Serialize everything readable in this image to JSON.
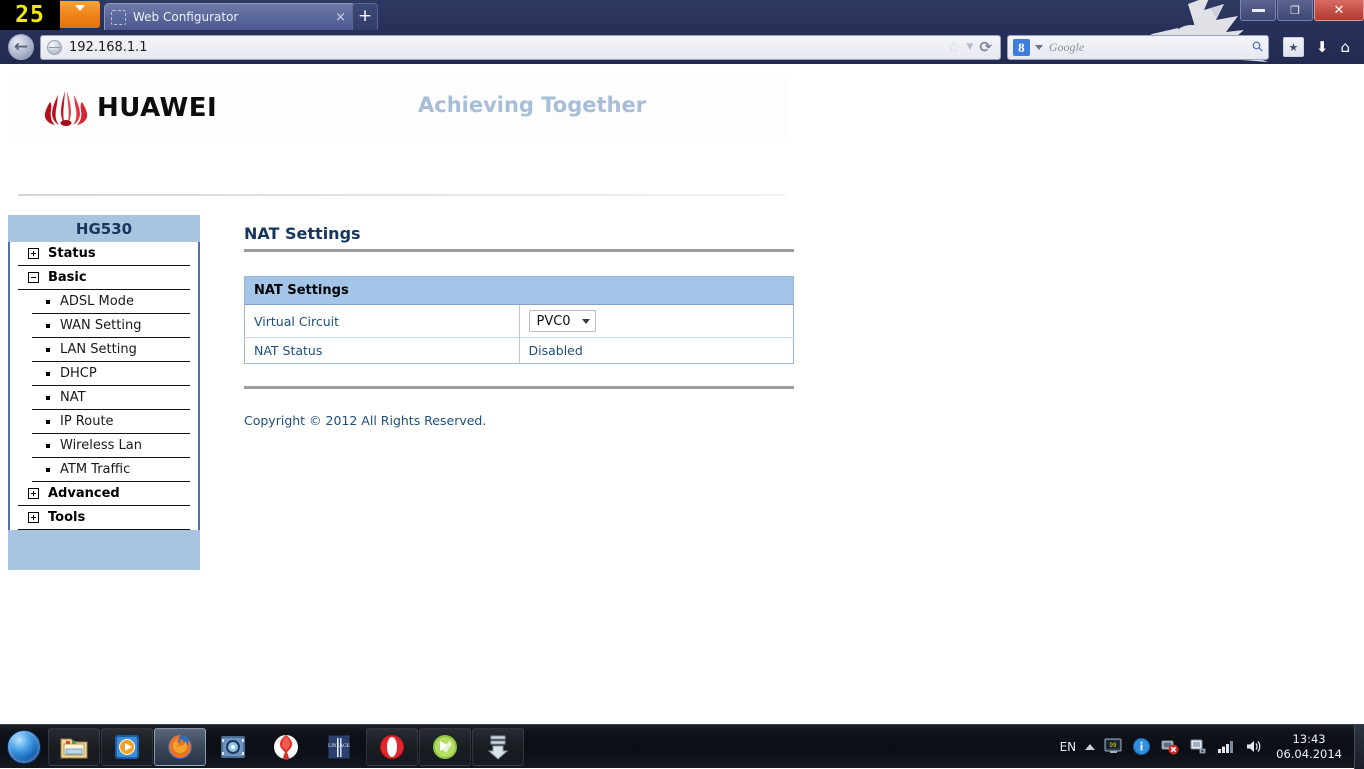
{
  "browser": {
    "logo_number": "25",
    "dropdown_icon": "caret-down-icon",
    "tab": {
      "title": "Web Configurator",
      "close_label": "×",
      "favicon": "blank-favicon-icon"
    },
    "new_tab_label": "+",
    "window_controls": {
      "minimize_label": "",
      "restore_label": "❐",
      "close_label": "✕"
    },
    "nav": {
      "back_label": "←",
      "url": "192.168.1.1",
      "url_favicon": "globe-icon",
      "star_icon": "star-icon",
      "chevron_icon": "chevron-down-icon",
      "reload_label": "⟳"
    },
    "search": {
      "engine_badge": "8",
      "placeholder": "Google",
      "magnifier_icon": "magnifier-icon"
    },
    "toolbar": {
      "bookmarks_icon": "bookmarks-star-icon",
      "downloads_icon": "download-arrow-icon",
      "home_icon": "home-icon"
    },
    "persona": "eagle-persona-image"
  },
  "page": {
    "header": {
      "brand": "HUAWEI",
      "slogan": "Achieving Together",
      "logo_icon": "huawei-flower-logo"
    },
    "sidebar": {
      "title": "HG530",
      "groups": [
        {
          "label": "Status",
          "state": "collapsed",
          "icon": "plus-box-icon",
          "items": []
        },
        {
          "label": "Basic",
          "state": "expanded",
          "icon": "minus-box-icon",
          "items": [
            "ADSL Mode",
            "WAN Setting",
            "LAN Setting",
            "DHCP",
            "NAT",
            "IP Route",
            "Wireless Lan",
            "ATM Traffic"
          ]
        },
        {
          "label": "Advanced",
          "state": "collapsed",
          "icon": "plus-box-icon",
          "items": []
        },
        {
          "label": "Tools",
          "state": "collapsed",
          "icon": "plus-box-icon",
          "items": []
        }
      ]
    },
    "main": {
      "title": "NAT Settings",
      "table": {
        "header": "NAT Settings",
        "rows": [
          {
            "label": "Virtual Circuit",
            "type": "select",
            "value": "PVC0"
          },
          {
            "label": "NAT Status",
            "type": "text",
            "value": "Disabled"
          }
        ]
      },
      "copyright": "Copyright © 2012 All Rights Reserved."
    },
    "colors": {
      "sidebar_header": "#a8c4e0",
      "table_header": "#a3c6e8",
      "title_blue": "#17365d",
      "label_blue": "#1f4e79",
      "huawei_red": "#cf1021",
      "slogan_blue": "#a8bdd8"
    }
  },
  "taskbar": {
    "start_label": "start-orb-icon",
    "buttons": [
      {
        "name": "explorer",
        "icon": "folder-icon",
        "active": false
      },
      {
        "name": "media-player",
        "icon": "media-player-icon",
        "active": false
      },
      {
        "name": "firefox",
        "icon": "firefox-icon",
        "active": true
      },
      {
        "name": "km-player",
        "icon": "kmplayer-icon",
        "active": false
      },
      {
        "name": "yandex",
        "icon": "yandex-browser-icon",
        "active": false
      },
      {
        "name": "lineage",
        "icon": "lineage-icon",
        "active": false
      },
      {
        "name": "opera",
        "icon": "opera-icon",
        "active": false
      },
      {
        "name": "utorrent",
        "icon": "green-app-icon",
        "active": false
      },
      {
        "name": "downloader",
        "icon": "download-arrow-icon",
        "active": false
      }
    ],
    "tray": {
      "language": "EN",
      "show_hidden_icon": "chevron-up-icon",
      "icons": [
        "monitor-99-icon",
        "action-center-info-icon",
        "network-error-icon",
        "safely-remove-icon",
        "signal-bars-icon",
        "volume-icon"
      ],
      "time": "13:43",
      "date": "06.04.2014"
    }
  }
}
